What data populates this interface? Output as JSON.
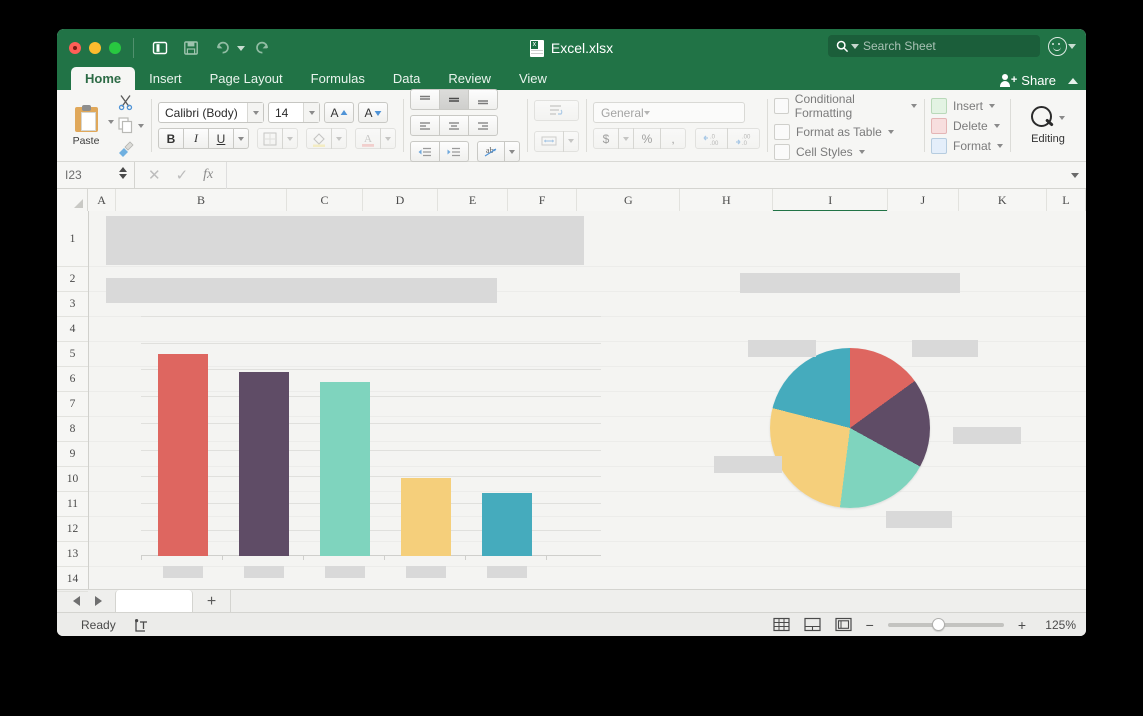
{
  "window": {
    "title": "Excel.xlsx",
    "traffic_lights": [
      "close",
      "minimize",
      "zoom"
    ]
  },
  "titlebar": {
    "quick_access": [
      "sidebar-toggle",
      "save",
      "undo",
      "redo",
      "customize"
    ],
    "search": {
      "placeholder": "Search Sheet"
    },
    "account": "account-icon"
  },
  "ribbon": {
    "tabs": [
      {
        "label": "Home",
        "active": true
      },
      {
        "label": "Insert",
        "active": false
      },
      {
        "label": "Page Layout",
        "active": false
      },
      {
        "label": "Formulas",
        "active": false
      },
      {
        "label": "Data",
        "active": false
      },
      {
        "label": "Review",
        "active": false
      },
      {
        "label": "View",
        "active": false
      }
    ],
    "share_label": "Share",
    "clipboard": {
      "paste_label": "Paste"
    },
    "font": {
      "family_value": "Calibri (Body)",
      "size_value": "14",
      "grow_label": "A",
      "shrink_label": "A",
      "bold_label": "B",
      "italic_label": "I",
      "underline_label": "U"
    },
    "number": {
      "format_value": "General",
      "currency_label": "$",
      "percent_label": "%",
      "comma_label": ","
    },
    "styles": [
      {
        "label": "Conditional Formatting"
      },
      {
        "label": "Format as Table"
      },
      {
        "label": "Cell Styles"
      }
    ],
    "cells": [
      {
        "label": "Insert"
      },
      {
        "label": "Delete"
      },
      {
        "label": "Format"
      }
    ],
    "editing": {
      "label": "Editing"
    }
  },
  "formula_bar": {
    "name_box_value": "I23",
    "cancel_label": "✕",
    "enter_label": "✓",
    "function_label": "fx",
    "input_value": ""
  },
  "grid": {
    "columns": [
      "A",
      "B",
      "C",
      "D",
      "E",
      "F",
      "G",
      "H",
      "I",
      "J",
      "K",
      "L"
    ],
    "selected_column": "I",
    "rows": [
      "1",
      "2",
      "3",
      "4",
      "5",
      "6",
      "7",
      "8",
      "9",
      "10",
      "11",
      "12",
      "13",
      "14"
    ]
  },
  "chart_data": [
    {
      "type": "bar",
      "title": "",
      "xlabel": "",
      "ylabel": "",
      "categories": [
        "",
        "",
        "",
        "",
        ""
      ],
      "values": [
        8,
        7.3,
        6.9,
        3.1,
        2.5
      ],
      "ylim": [
        0,
        9.5
      ],
      "grid": true,
      "legend": "none",
      "colors": [
        "#de6660",
        "#5f4c66",
        "#7fd4be",
        "#f5cf7b",
        "#45abbd"
      ]
    },
    {
      "type": "pie",
      "title": "",
      "labels": [
        "",
        "",
        "",
        "",
        ""
      ],
      "values": [
        15,
        18,
        19,
        27,
        21
      ],
      "legend": "none",
      "start_angle_deg": 0,
      "colors": [
        "#de6660",
        "#5f4c66",
        "#7fd4be",
        "#f5cf7b",
        "#45abbd"
      ]
    }
  ],
  "sheet_tabs": {
    "prev_label": "◀",
    "next_label": "▶",
    "tabs": [
      {
        "label": ""
      }
    ],
    "add_label": "+"
  },
  "status_bar": {
    "status_text": "Ready",
    "views": [
      "normal-view",
      "page-layout-view",
      "page-break-view"
    ],
    "zoom_out_label": "−",
    "zoom_in_label": "+",
    "zoom_level": "125%"
  },
  "colors": {
    "brand_green": "#217346",
    "chart_red": "#de6660",
    "chart_purple": "#5f4c66",
    "chart_mint": "#7fd4be",
    "chart_yellow": "#f5cf7b",
    "chart_teal": "#45abbd",
    "placeholder_gray": "#d9d9d9"
  }
}
